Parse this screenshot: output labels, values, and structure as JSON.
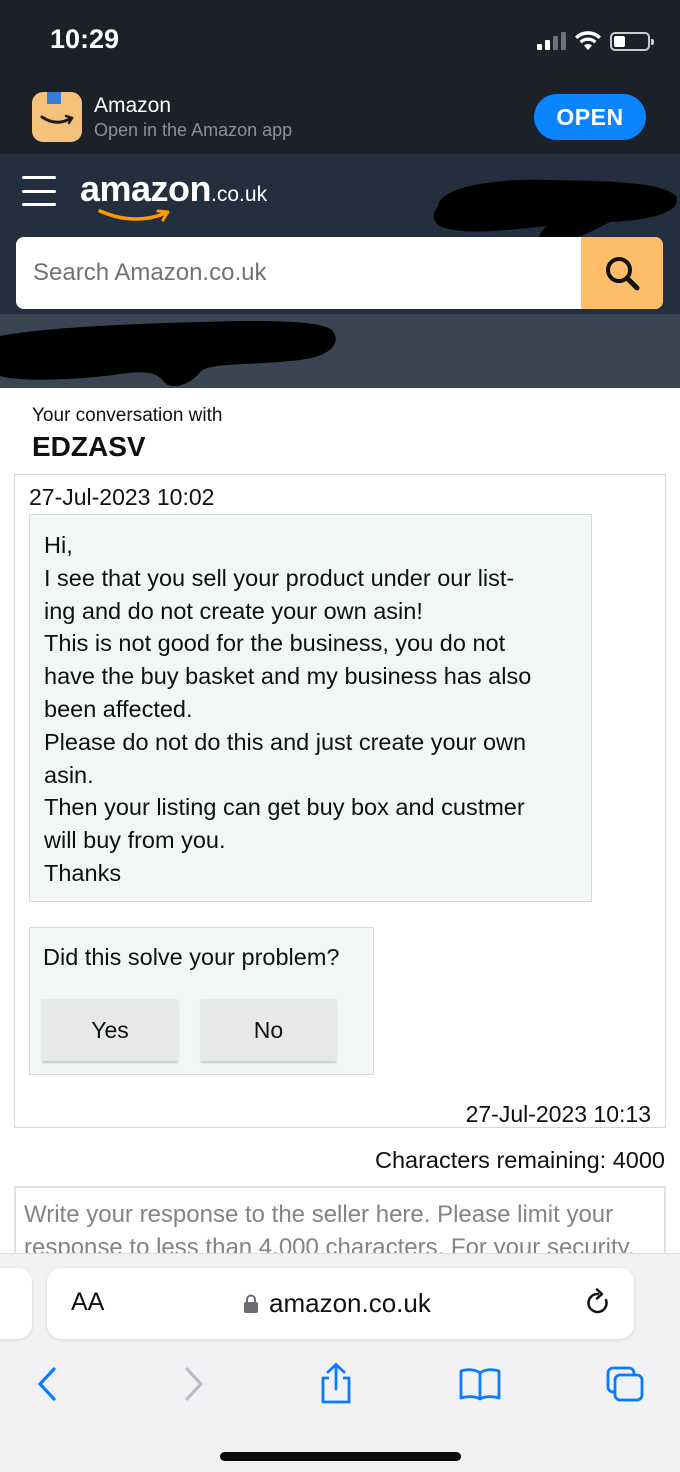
{
  "status_bar": {
    "time": "10:29",
    "icons": [
      "cellular-signal-icon",
      "wifi-icon",
      "battery-icon"
    ]
  },
  "app_banner": {
    "app_name": "Amazon",
    "subtitle": "Open in the Amazon app",
    "open_label": "OPEN"
  },
  "header": {
    "logo_word": "amazon",
    "logo_tld": ".co.uk",
    "search_placeholder": "Search Amazon.co.uk"
  },
  "conversation": {
    "label": "Your conversation with",
    "seller": "EDZASV",
    "message": {
      "date": "27-Jul-2023 10:02",
      "lines": [
        "Hi,",
        "I see that you sell your product under our list-",
        "ing and do not create your own asin!",
        "This is not good for the business, you do not",
        "have the buy basket and my business has also",
        "been affected.",
        "Please do not do this and just create your own",
        "asin.",
        "Then your listing can get buy box and custmer",
        "will buy from you.",
        "Thanks"
      ]
    },
    "feedback": {
      "question": "Did this solve your problem?",
      "yes_label": "Yes",
      "no_label": "No"
    },
    "reply_date": "27-Jul-2023 10:13",
    "chars_remaining": "Characters remaining: 4000",
    "response_placeholder": "Write your response to the seller here. Please limit your response to less than 4,000 characters. For your security,"
  },
  "browser": {
    "text_size_label": "AA",
    "url": "amazon.co.uk"
  },
  "colors": {
    "status_bg": "#1b2029",
    "header_bg": "#232f3e",
    "subnav_bg": "#3a4553",
    "search_button": "#febd69",
    "open_button": "#0a84ff",
    "safari_blue": "#0a7aff"
  }
}
